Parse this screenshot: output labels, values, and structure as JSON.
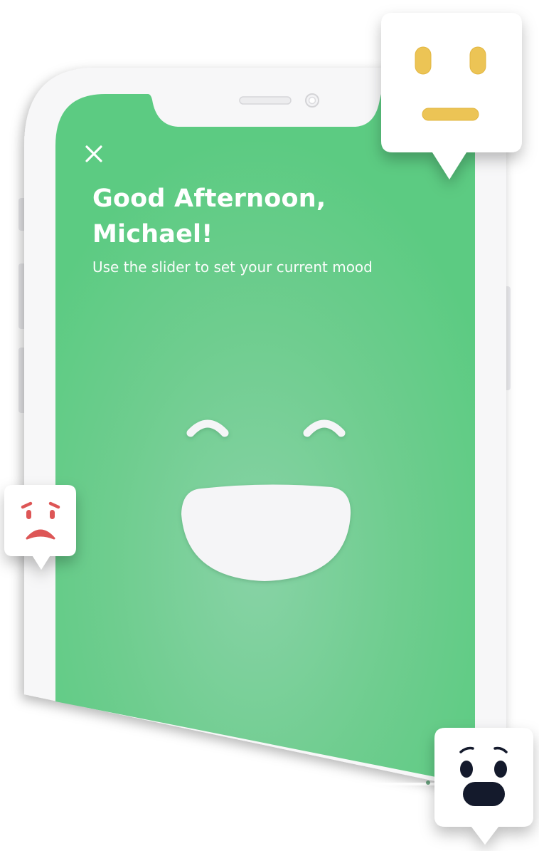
{
  "header": {
    "greeting_line1": "Good Afternoon,",
    "greeting_line2": "Michael!",
    "subtitle": "Use the slider to set your current mood"
  },
  "mood": {
    "current": "very-happy",
    "screen_color": "#5ccb82",
    "screen_center_color": "#88d3a6"
  },
  "floating_moods": [
    {
      "name": "neutral",
      "color": "#ecc455"
    },
    {
      "name": "sad",
      "color": "#dd5656"
    },
    {
      "name": "surprised",
      "color": "#141a2c"
    }
  ],
  "icons": {
    "close": "close-icon"
  }
}
